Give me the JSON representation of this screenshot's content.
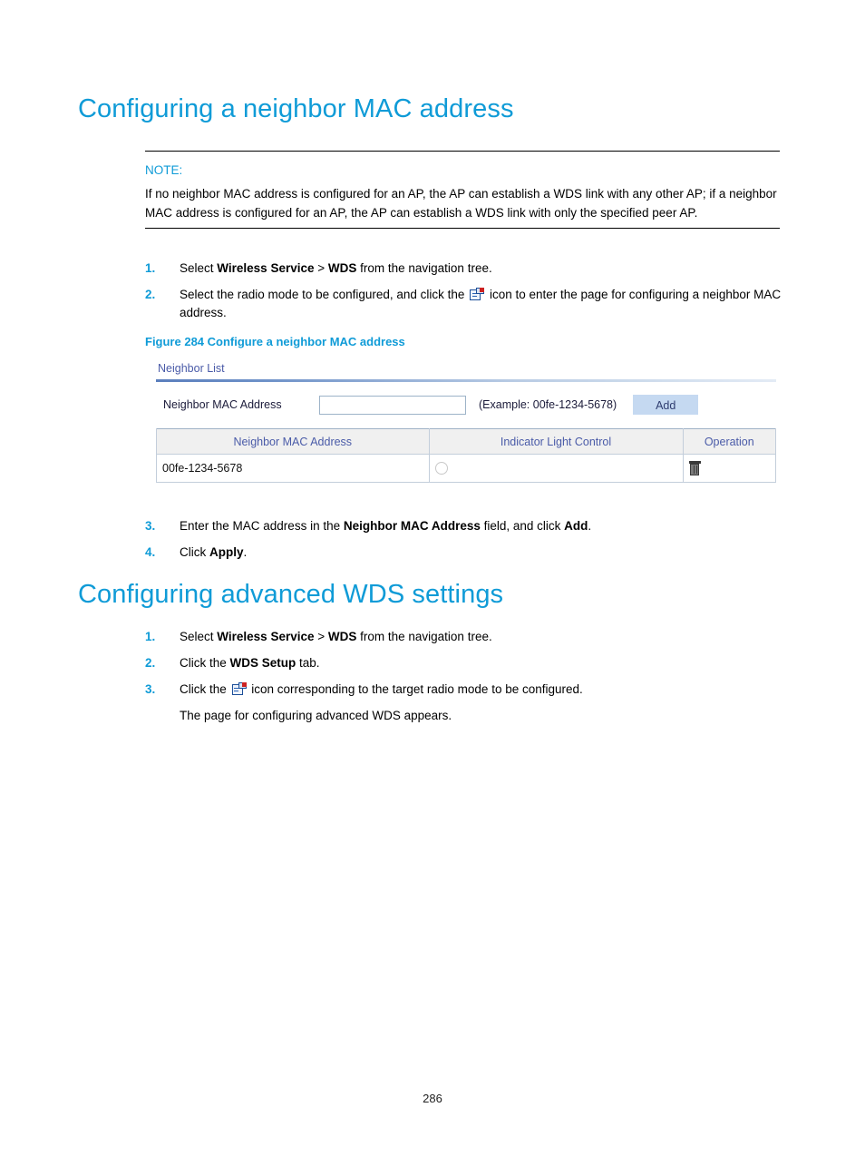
{
  "document": {
    "page_number": "286",
    "accent_color": "#0f9bd7",
    "body_text_color": "#000000"
  },
  "section_1": {
    "heading": "Configuring a neighbor MAC address",
    "note": {
      "label": "NOTE:",
      "body": "If no neighbor MAC address is configured for an AP, the AP can establish a WDS link with any other AP; if a neighbor MAC address is configured for an AP, the AP can establish a WDS link with only the specified peer AP."
    },
    "steps_before_figure": [
      {
        "number": "1.",
        "parts": [
          {
            "text": "Select ",
            "bold": false
          },
          {
            "text": "Wireless Service",
            "bold": true
          },
          {
            "text": " > ",
            "bold": false
          },
          {
            "text": "WDS",
            "bold": true
          },
          {
            "text": " from the navigation tree.",
            "bold": false
          }
        ]
      },
      {
        "number": "2.",
        "parts": [
          {
            "text": "Select the radio mode to be configured, and click the ",
            "bold": false
          },
          {
            "icon": "wds-config-page-icon"
          },
          {
            "text": " icon to enter the page for configuring a neighbor MAC address.",
            "bold": false
          }
        ]
      }
    ],
    "figure": {
      "caption": "Figure 284 Configure a neighbor MAC address",
      "panel_title": "Neighbor List",
      "form": {
        "label": "Neighbor MAC Address",
        "input_value": "",
        "input_placeholder": "",
        "example_text": "(Example: 00fe-1234-5678)",
        "add_button": "Add",
        "add_button_color": "#c5d9f1"
      },
      "table": {
        "columns": [
          "Neighbor MAC Address",
          "Indicator Light Control",
          "Operation"
        ],
        "rows": [
          {
            "mac": "00fe-1234-5678",
            "indicator_light": "unchecked",
            "operation_icon": "delete-trash-icon"
          }
        ],
        "header_text_color": "#4a5ba8",
        "header_bg_color": "#f0f0f0"
      }
    },
    "steps_after_figure": [
      {
        "number": "3.",
        "parts": [
          {
            "text": "Enter the MAC address in the ",
            "bold": false
          },
          {
            "text": "Neighbor MAC Address",
            "bold": true
          },
          {
            "text": " field, and click ",
            "bold": false
          },
          {
            "text": "Add",
            "bold": true
          },
          {
            "text": ".",
            "bold": false
          }
        ]
      },
      {
        "number": "4.",
        "parts": [
          {
            "text": "Click ",
            "bold": false
          },
          {
            "text": "Apply",
            "bold": true
          },
          {
            "text": ".",
            "bold": false
          }
        ]
      }
    ]
  },
  "section_2": {
    "heading": "Configuring advanced WDS settings",
    "steps": [
      {
        "number": "1.",
        "parts": [
          {
            "text": "Select ",
            "bold": false
          },
          {
            "text": "Wireless Service",
            "bold": true
          },
          {
            "text": " > ",
            "bold": false
          },
          {
            "text": "WDS",
            "bold": true
          },
          {
            "text": " from the navigation tree.",
            "bold": false
          }
        ]
      },
      {
        "number": "2.",
        "parts": [
          {
            "text": "Click the ",
            "bold": false
          },
          {
            "text": "WDS Setup",
            "bold": true
          },
          {
            "text": " tab.",
            "bold": false
          }
        ]
      },
      {
        "number": "3.",
        "parts": [
          {
            "text": "Click the ",
            "bold": false
          },
          {
            "icon": "wds-config-page-icon"
          },
          {
            "text": " icon corresponding to the target radio mode to be configured.",
            "bold": false
          }
        ],
        "sub_text": "The page for configuring advanced WDS appears."
      }
    ]
  }
}
